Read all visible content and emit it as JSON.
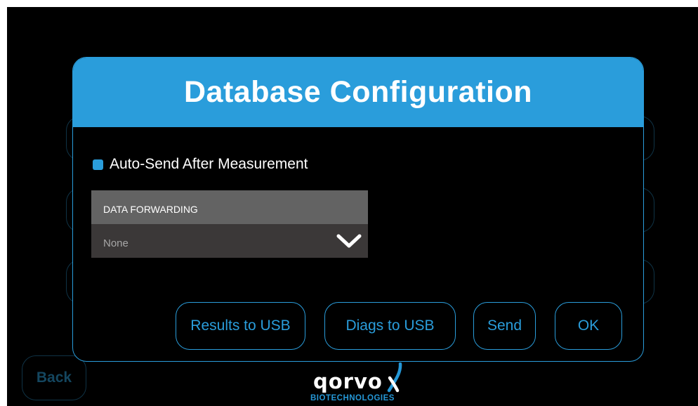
{
  "modal": {
    "title": "Database Configuration",
    "auto_send_label": "Auto-Send After Measurement",
    "auto_send_checked": true,
    "dropdown": {
      "label": "DATA FORWARDING",
      "selected": "None"
    },
    "buttons": {
      "results_to_usb": "Results to USB",
      "diags_to_usb": "Diags to USB",
      "send": "Send",
      "ok": "OK"
    }
  },
  "back_label": "Back",
  "logo": {
    "word": "qorvo",
    "sub": "BIOTECHNOLOGIES"
  },
  "colors": {
    "accent": "#2a9ddb",
    "background": "#000000",
    "dropdown_label_bg": "#636363",
    "dropdown_select_bg": "#3b3838"
  },
  "icons": [
    "chevron-down-icon",
    "qorvo-logo-mark-icon"
  ]
}
